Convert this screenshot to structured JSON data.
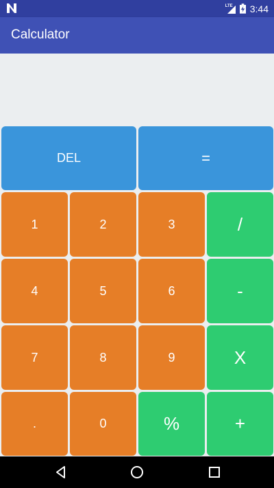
{
  "status_bar": {
    "time": "3:44",
    "network": "LTE",
    "icons": [
      "n-notification-icon",
      "lte-signal-icon",
      "battery-charging-icon"
    ]
  },
  "app_bar": {
    "title": "Calculator"
  },
  "display": {
    "value": ""
  },
  "keys": {
    "del": "DEL",
    "equals": "=",
    "one": "1",
    "two": "2",
    "three": "3",
    "divide": "/",
    "four": "4",
    "five": "5",
    "six": "6",
    "minus": "-",
    "seven": "7",
    "eight": "8",
    "nine": "9",
    "multiply": "X",
    "dot": ".",
    "zero": "0",
    "percent": "%",
    "plus": "+"
  },
  "colors": {
    "primary_dark": "#303f9f",
    "primary": "#3f51b5",
    "action_blue": "#3a95db",
    "digit_orange": "#e67e27",
    "operator_green": "#2ecc71",
    "background": "#ebeef0"
  },
  "nav_bar": {
    "icons": [
      "back-icon",
      "home-icon",
      "recents-icon"
    ]
  }
}
